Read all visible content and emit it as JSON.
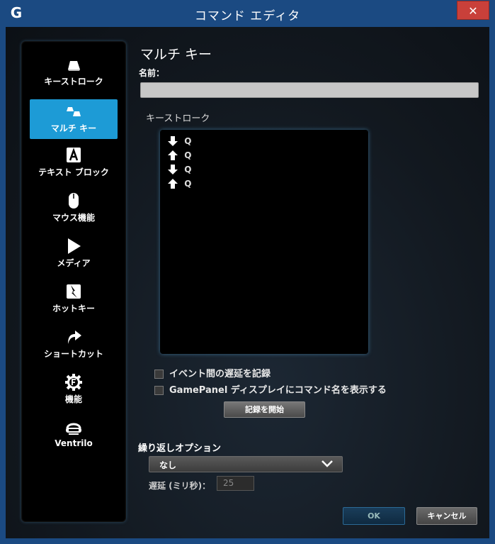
{
  "window": {
    "title": "コマンド エディタ",
    "close_label": "✕",
    "logo": "G"
  },
  "sidebar": {
    "items": [
      {
        "label": "キーストローク",
        "icon": "key-icon"
      },
      {
        "label": "マルチ キー",
        "icon": "multi-key-icon",
        "active": true
      },
      {
        "label": "テキスト ブロック",
        "icon": "text-block-icon"
      },
      {
        "label": "マウス機能",
        "icon": "mouse-icon"
      },
      {
        "label": "メディア",
        "icon": "play-icon"
      },
      {
        "label": "ホットキー",
        "icon": "hotkey-icon"
      },
      {
        "label": "ショートカット",
        "icon": "shortcut-icon"
      },
      {
        "label": "機能",
        "icon": "function-icon"
      },
      {
        "label": "Ventrilo",
        "icon": "headset-icon"
      }
    ]
  },
  "main": {
    "title": "マルチ キー",
    "name_label": "名前：",
    "name_value": "",
    "keystroke_label": "キーストローク",
    "keystrokes": [
      {
        "direction": "down",
        "key": "Q"
      },
      {
        "direction": "up",
        "key": "Q"
      },
      {
        "direction": "down",
        "key": "Q"
      },
      {
        "direction": "up",
        "key": "Q"
      }
    ],
    "check_record_delay": "イベント間の遅延を記録",
    "check_gamepanel": "GamePanel ディスプレイにコマンド名を表示する",
    "record_button": "記録を開始",
    "repeat_label": "繰り返しオプション",
    "repeat_value": "なし",
    "delay_label": "遅延 (ミリ秒)：",
    "delay_value": "25",
    "ok_button": "OK",
    "cancel_button": "キャンセル"
  }
}
